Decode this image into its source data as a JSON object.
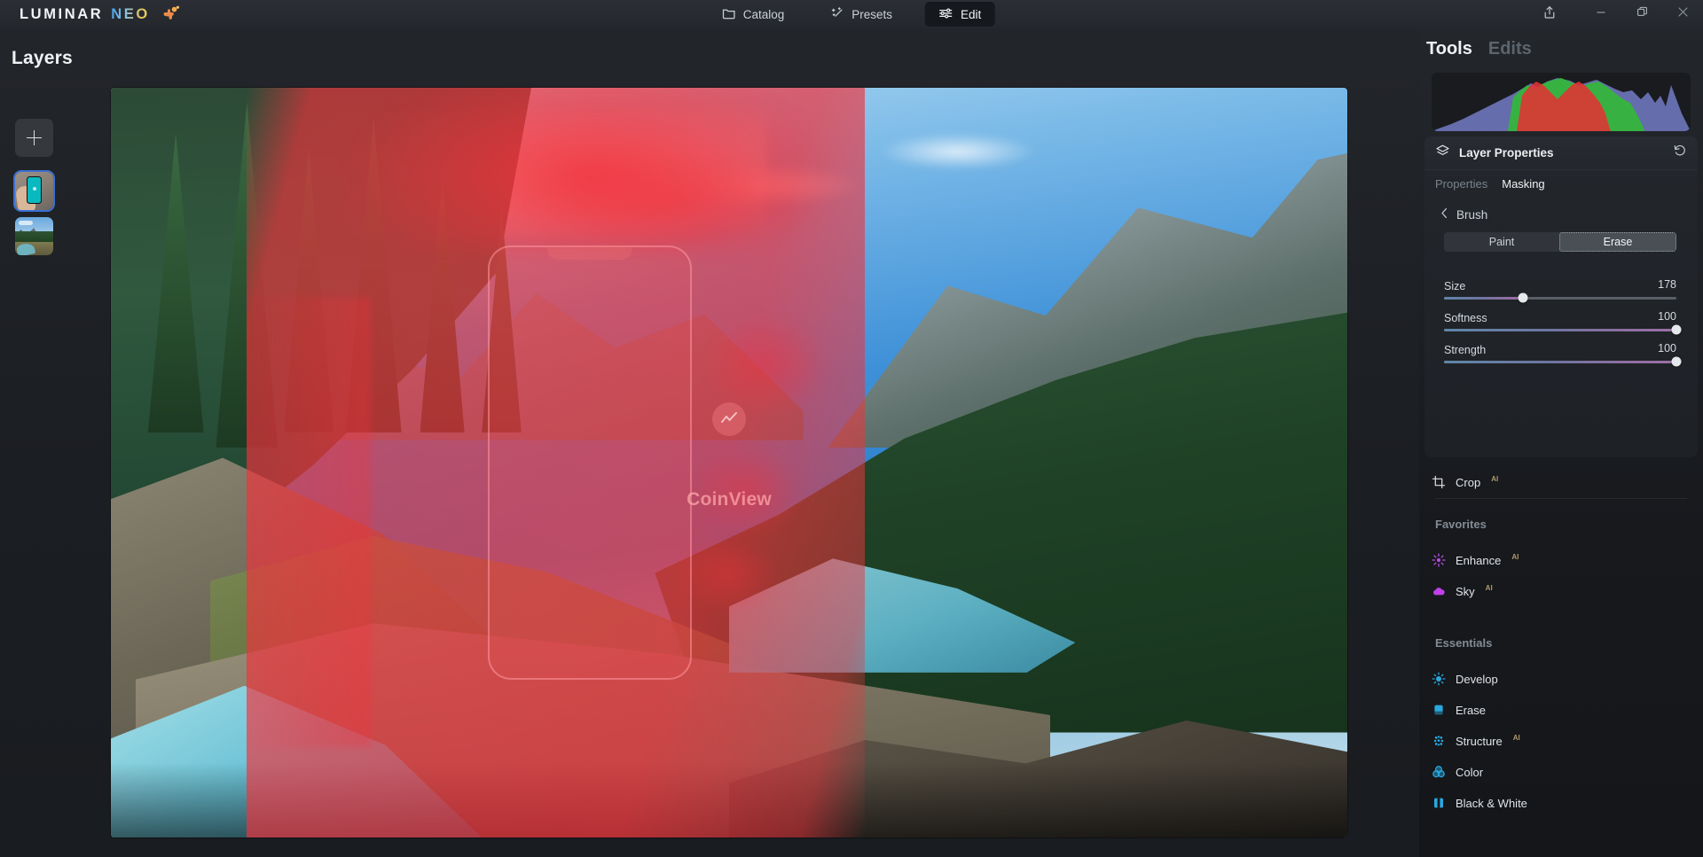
{
  "app": {
    "brand_primary": "LUMINAR",
    "brand_secondary": "NEO",
    "logo_icon": "puzzle-icon"
  },
  "titlebar": {
    "nav": [
      {
        "label": "Catalog",
        "icon": "folder-icon",
        "active": false
      },
      {
        "label": "Presets",
        "icon": "magic-wand-icon",
        "active": false
      },
      {
        "label": "Edit",
        "icon": "sliders-icon",
        "active": true
      }
    ],
    "window_controls": [
      {
        "name": "share-button",
        "icon": "share-icon"
      },
      {
        "name": "minimize-button",
        "icon": "minimize-icon"
      },
      {
        "name": "maximize-button",
        "icon": "restore-icon"
      },
      {
        "name": "close-button",
        "icon": "close-icon"
      }
    ]
  },
  "layers": {
    "title": "Layers",
    "add_label": "+",
    "items": [
      {
        "name": "layer-phone-mockup",
        "selected": true
      },
      {
        "name": "layer-background-landscape",
        "selected": false
      }
    ]
  },
  "canvas": {
    "overlay_brand": "CoinView",
    "overlay_logo": "coinview-logo-icon",
    "mask_color": "#f0323c"
  },
  "right_panel": {
    "tabs": [
      {
        "label": "Tools",
        "active": true
      },
      {
        "label": "Edits",
        "active": false
      }
    ],
    "histogram": {
      "title": "rgb-histogram",
      "channels": [
        "red",
        "green",
        "blue"
      ]
    },
    "layer_properties": {
      "title": "Layer Properties",
      "icon": "layers-icon",
      "reset_icon": "undo-icon",
      "subtabs": [
        {
          "label": "Properties",
          "active": false
        },
        {
          "label": "Masking",
          "active": true
        }
      ],
      "brush": {
        "back_label": "Brush",
        "back_icon": "chevron-left-icon",
        "modes": [
          {
            "label": "Paint",
            "active": false
          },
          {
            "label": "Erase",
            "active": true
          }
        ],
        "sliders": [
          {
            "label": "Size",
            "value": "178",
            "percent": 34
          },
          {
            "label": "Softness",
            "value": "100",
            "percent": 100
          },
          {
            "label": "Strength",
            "value": "100",
            "percent": 100
          }
        ]
      }
    },
    "crop_tool": {
      "label": "Crop",
      "ai": "AI",
      "icon": "crop-icon"
    },
    "sections": [
      {
        "title": "Favorites",
        "tools": [
          {
            "label": "Enhance",
            "ai": "AI",
            "icon": "enhance-icon",
            "color": "#b14fe0"
          },
          {
            "label": "Sky",
            "ai": "AI",
            "icon": "sky-icon",
            "color": "#c040e8"
          }
        ]
      },
      {
        "title": "Essentials",
        "tools": [
          {
            "label": "Develop",
            "ai": "",
            "icon": "develop-icon",
            "color": "#29a8e0"
          },
          {
            "label": "Erase",
            "ai": "",
            "icon": "erase-icon",
            "color": "#29a8e0"
          },
          {
            "label": "Structure",
            "ai": "AI",
            "icon": "structure-icon",
            "color": "#29a8e0"
          },
          {
            "label": "Color",
            "ai": "",
            "icon": "color-icon",
            "color": "#29a8e0"
          },
          {
            "label": "Black & White",
            "ai": "",
            "icon": "black-white-icon",
            "color": "#29a8e0"
          }
        ]
      }
    ]
  }
}
